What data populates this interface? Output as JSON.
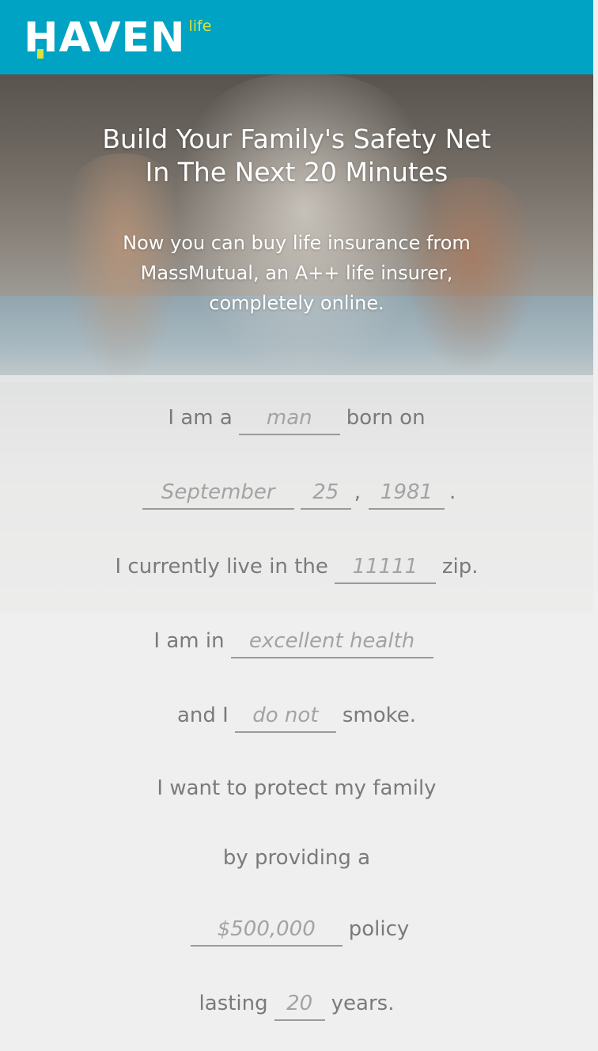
{
  "header": {
    "brand": "HAVEN",
    "brand_suffix": "life",
    "bg_color": "#00a3c3",
    "accent_color": "#d7e33c"
  },
  "hero": {
    "title_line1": "Build Your Family's Safety Net",
    "title_line2": "In The Next 20 Minutes",
    "subtitle_line1": "Now you can buy life insurance from",
    "subtitle_line2": "MassMutual, an A++ life insurer,",
    "subtitle_line3": "completely online."
  },
  "form": {
    "line1": {
      "prefix": "I am a",
      "gender_placeholder": "man",
      "suffix": "born on"
    },
    "line2": {
      "month_placeholder": "September",
      "day_placeholder": "25",
      "comma": ",",
      "year_placeholder": "1981",
      "period": "."
    },
    "line3": {
      "prefix": "I currently live in the",
      "zip_placeholder": "11111",
      "suffix": "zip."
    },
    "line4": {
      "prefix": "I am in",
      "health_placeholder": "excellent health"
    },
    "line5": {
      "prefix": "and I",
      "smoke_placeholder": "do not",
      "suffix": "smoke."
    },
    "line6": {
      "text": "I want to protect my family"
    },
    "line7": {
      "text": "by providing a"
    },
    "line8": {
      "coverage_placeholder": "$500,000",
      "suffix": "policy"
    },
    "line9": {
      "prefix": "lasting",
      "term_placeholder": "20",
      "suffix": "years."
    }
  }
}
